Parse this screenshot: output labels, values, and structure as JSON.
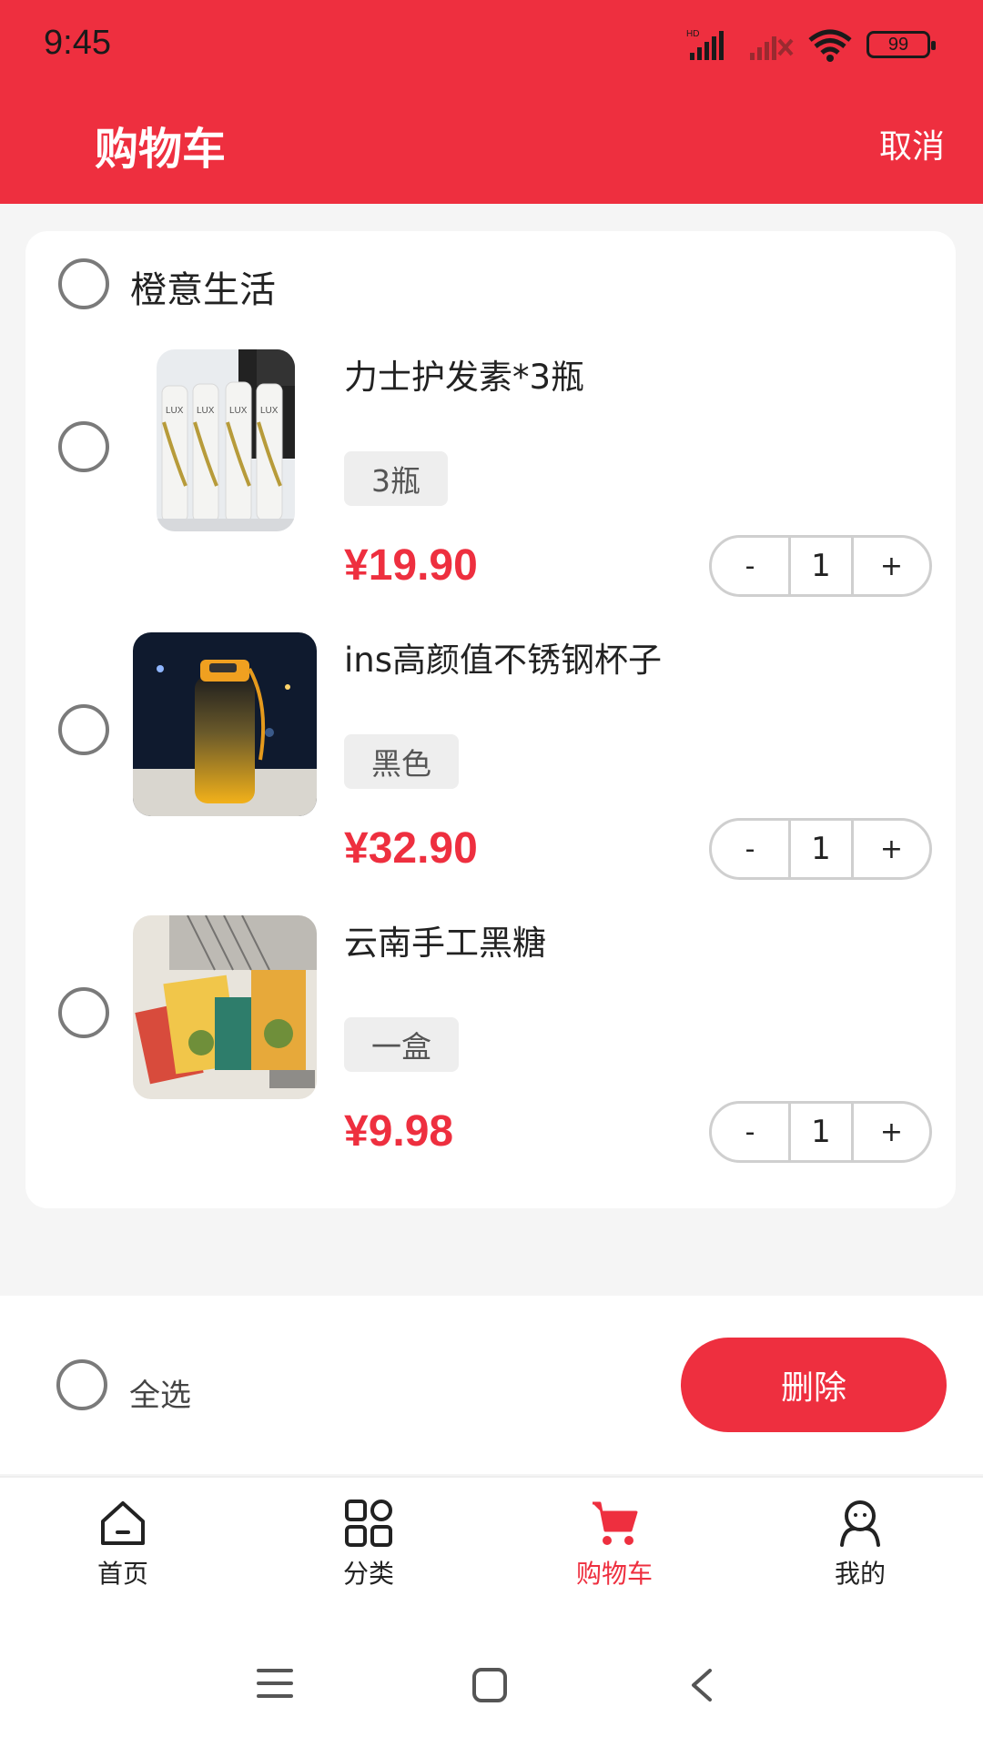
{
  "status_bar": {
    "time": "9:45",
    "battery": "99"
  },
  "header": {
    "title": "购物车",
    "cancel": "取消"
  },
  "store": {
    "name": "橙意生活"
  },
  "items": [
    {
      "name": "力士护发素*3瓶",
      "spec": "3瓶",
      "price": "¥19.90",
      "qty": "1"
    },
    {
      "name": "ins高颜值不锈钢杯子",
      "spec": "黑色",
      "price": "¥32.90",
      "qty": "1"
    },
    {
      "name": "云南手工黑糖",
      "spec": "一盒",
      "price": "¥9.98",
      "qty": "1"
    }
  ],
  "stepper": {
    "minus": "-",
    "plus": "+"
  },
  "action_bar": {
    "select_all": "全选",
    "delete": "删除"
  },
  "tabs": [
    {
      "label": "首页",
      "icon": "home-icon"
    },
    {
      "label": "分类",
      "icon": "category-icon"
    },
    {
      "label": "购物车",
      "icon": "cart-icon"
    },
    {
      "label": "我的",
      "icon": "profile-icon"
    }
  ],
  "colors": {
    "accent": "#ee2f3f",
    "background": "#f5f5f5"
  }
}
